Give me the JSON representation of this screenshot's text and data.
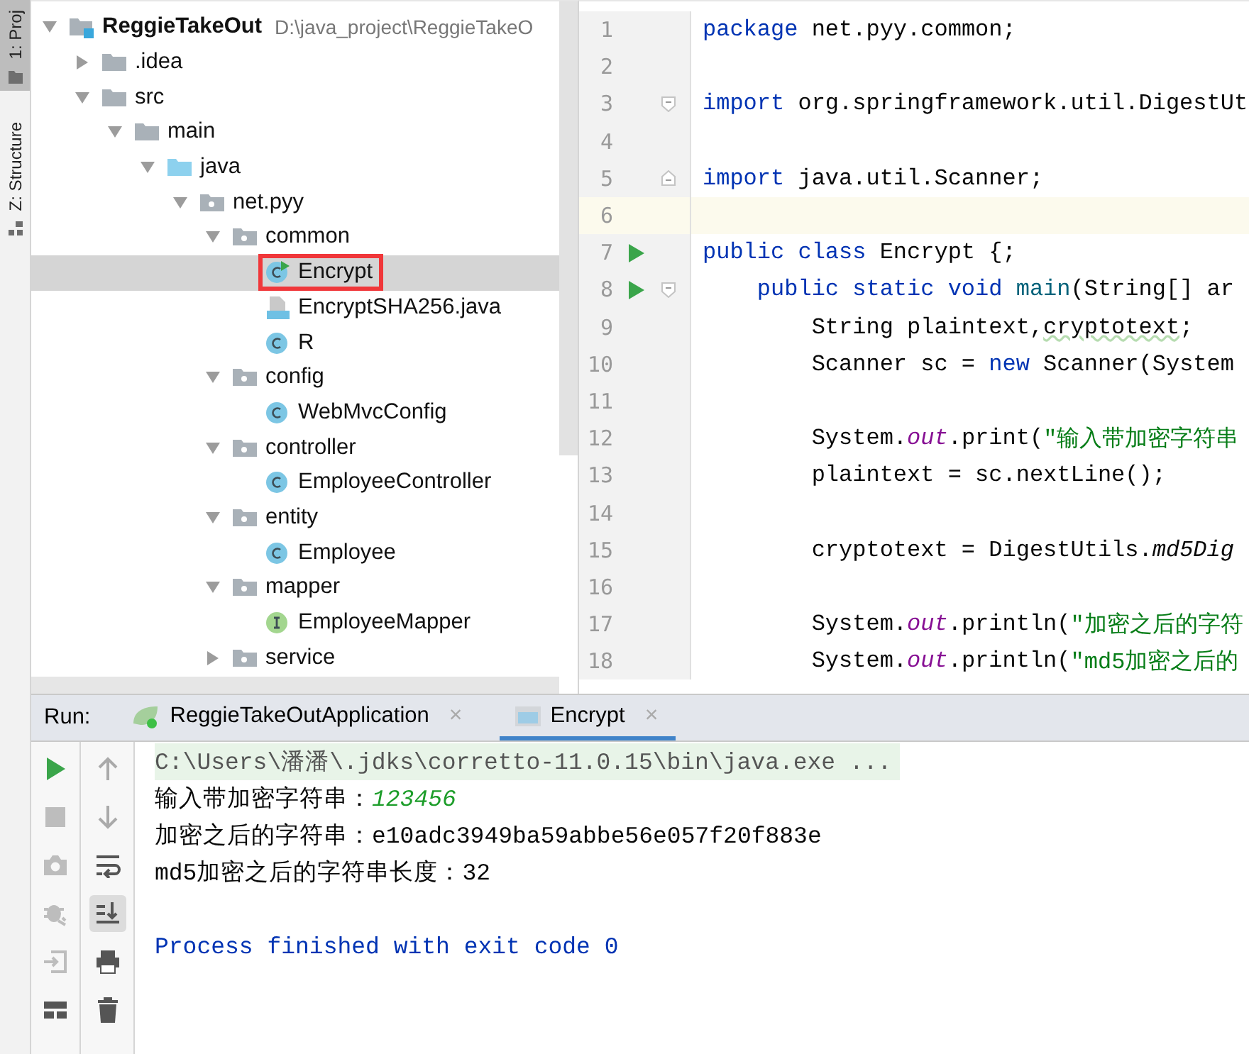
{
  "side_strip": [
    {
      "label": "1: Proj",
      "selected": true,
      "kind": "folder"
    },
    {
      "label": "Z: Structure",
      "selected": false,
      "kind": "structure"
    }
  ],
  "project_tree": [
    {
      "name": "ReggieTakeOut",
      "path": "D:\\java_project\\ReggieTakeO",
      "kind": "module",
      "expanded": true,
      "selected": false,
      "boxed": false,
      "children": [
        {
          "name": ".idea",
          "kind": "folder",
          "expanded": false,
          "selected": false,
          "boxed": false
        },
        {
          "name": "src",
          "kind": "folder",
          "expanded": true,
          "selected": false,
          "boxed": false,
          "children": [
            {
              "name": "main",
              "kind": "folder",
              "expanded": true,
              "selected": false,
              "boxed": false,
              "children": [
                {
                  "name": "java",
                  "kind": "source",
                  "expanded": true,
                  "selected": false,
                  "boxed": false,
                  "children": [
                    {
                      "name": "net.pyy",
                      "kind": "package",
                      "expanded": true,
                      "selected": false,
                      "boxed": false,
                      "children": [
                        {
                          "name": "common",
                          "kind": "package",
                          "expanded": true,
                          "selected": false,
                          "boxed": false,
                          "children": [
                            {
                              "name": "Encrypt",
                              "kind": "runnable",
                              "selected": true,
                              "boxed": true
                            },
                            {
                              "name": "EncryptSHA256.java",
                              "kind": "file",
                              "selected": false,
                              "boxed": false
                            },
                            {
                              "name": "R",
                              "kind": "class",
                              "selected": false,
                              "boxed": false
                            }
                          ]
                        },
                        {
                          "name": "config",
                          "kind": "package",
                          "expanded": true,
                          "selected": false,
                          "boxed": false,
                          "children": [
                            {
                              "name": "WebMvcConfig",
                              "kind": "class",
                              "selected": false,
                              "boxed": false
                            }
                          ]
                        },
                        {
                          "name": "controller",
                          "kind": "package",
                          "expanded": true,
                          "selected": false,
                          "boxed": false,
                          "children": [
                            {
                              "name": "EmployeeController",
                              "kind": "class",
                              "selected": false,
                              "boxed": false
                            }
                          ]
                        },
                        {
                          "name": "entity",
                          "kind": "package",
                          "expanded": true,
                          "selected": false,
                          "boxed": false,
                          "children": [
                            {
                              "name": "Employee",
                              "kind": "class",
                              "selected": false,
                              "boxed": false
                            }
                          ]
                        },
                        {
                          "name": "mapper",
                          "kind": "package",
                          "expanded": true,
                          "selected": false,
                          "boxed": false,
                          "children": [
                            {
                              "name": "EmployeeMapper",
                              "kind": "interface",
                              "selected": false,
                              "boxed": false
                            }
                          ]
                        },
                        {
                          "name": "service",
                          "kind": "package",
                          "expanded": false,
                          "selected": false,
                          "boxed": false
                        }
                      ]
                    }
                  ]
                }
              ]
            }
          ]
        }
      ]
    }
  ],
  "editor": {
    "lines": [
      {
        "number": "1",
        "run": false,
        "fold_open": false,
        "fold_close": false,
        "current": false,
        "tokens": [
          {
            "kind": "keyword",
            "t": "package"
          },
          {
            "kind": "plain",
            "t": " net.pyy.common;"
          }
        ]
      },
      {
        "number": "2",
        "run": false,
        "fold_open": false,
        "fold_close": false,
        "current": false
      },
      {
        "number": "3",
        "run": false,
        "fold_open": true,
        "fold_close": false,
        "current": false,
        "tokens": [
          {
            "kind": "keyword",
            "t": "import"
          },
          {
            "kind": "plain",
            "t": " org.springframework.util.DigestUt"
          }
        ]
      },
      {
        "number": "4",
        "run": false,
        "fold_open": false,
        "fold_close": false,
        "current": false
      },
      {
        "number": "5",
        "run": false,
        "fold_open": false,
        "fold_close": true,
        "current": false,
        "tokens": [
          {
            "kind": "keyword",
            "t": "import"
          },
          {
            "kind": "plain",
            "t": " java.util.Scanner;"
          }
        ]
      },
      {
        "number": "6",
        "run": false,
        "fold_open": false,
        "fold_close": false,
        "current": true
      },
      {
        "number": "7",
        "run": true,
        "fold_open": false,
        "fold_close": false,
        "current": false,
        "tokens": [
          {
            "kind": "keyword",
            "t": "public class"
          },
          {
            "kind": "plain",
            "t": " Encrypt {;"
          }
        ]
      },
      {
        "number": "8",
        "run": true,
        "fold_open": true,
        "fold_close": false,
        "current": false,
        "tokens": [
          {
            "kind": "keyword",
            "t": "    public static void"
          },
          {
            "kind": "method",
            "t": " main"
          },
          {
            "kind": "plain",
            "t": "(String[] ar"
          }
        ]
      },
      {
        "number": "9",
        "run": false,
        "fold_open": false,
        "fold_close": false,
        "current": false,
        "tokens": [
          {
            "kind": "plain",
            "t": "        String plaintext,"
          },
          {
            "kind": "warning",
            "t": "cryptotext"
          },
          {
            "kind": "plain",
            "t": ";"
          }
        ]
      },
      {
        "number": "10",
        "run": false,
        "fold_open": false,
        "fold_close": false,
        "current": false,
        "tokens": [
          {
            "kind": "plain",
            "t": "        Scanner sc = "
          },
          {
            "kind": "keyword",
            "t": "new"
          },
          {
            "kind": "plain",
            "t": " Scanner(System"
          }
        ]
      },
      {
        "number": "11",
        "run": false,
        "fold_open": false,
        "fold_close": false,
        "current": false
      },
      {
        "number": "12",
        "run": false,
        "fold_open": false,
        "fold_close": false,
        "current": false,
        "tokens": [
          {
            "kind": "plain",
            "t": "        System."
          },
          {
            "kind": "field",
            "t": "out"
          },
          {
            "kind": "plain",
            "t": ".print("
          },
          {
            "kind": "string",
            "t": "\"输入带加密字符串"
          }
        ]
      },
      {
        "number": "13",
        "run": false,
        "fold_open": false,
        "fold_close": false,
        "current": false,
        "tokens": [
          {
            "kind": "plain",
            "t": "        plaintext = sc.nextLine();"
          }
        ]
      },
      {
        "number": "14",
        "run": false,
        "fold_open": false,
        "fold_close": false,
        "current": false
      },
      {
        "number": "15",
        "run": false,
        "fold_open": false,
        "fold_close": false,
        "current": false,
        "tokens": [
          {
            "kind": "plain",
            "t": "        cryptotext = DigestUtils."
          },
          {
            "kind": "call",
            "t": "md5Dig"
          }
        ]
      },
      {
        "number": "16",
        "run": false,
        "fold_open": false,
        "fold_close": false,
        "current": false
      },
      {
        "number": "17",
        "run": false,
        "fold_open": false,
        "fold_close": false,
        "current": false,
        "tokens": [
          {
            "kind": "plain",
            "t": "        System."
          },
          {
            "kind": "field",
            "t": "out"
          },
          {
            "kind": "plain",
            "t": ".println("
          },
          {
            "kind": "string",
            "t": "\"加密之后的字符"
          }
        ]
      },
      {
        "number": "18",
        "run": false,
        "fold_open": false,
        "fold_close": false,
        "current": false,
        "tokens": [
          {
            "kind": "plain",
            "t": "        System."
          },
          {
            "kind": "field",
            "t": "out"
          },
          {
            "kind": "plain",
            "t": ".println("
          },
          {
            "kind": "string",
            "t": "\"md5加密之后的"
          }
        ]
      }
    ]
  },
  "run_panel": {
    "label": "Run:",
    "tabs": [
      {
        "label": "ReggieTakeOutApplication",
        "kind": "spring",
        "selected": false,
        "close": "×"
      },
      {
        "label": "Encrypt",
        "kind": "console",
        "selected": true,
        "close": "×"
      }
    ],
    "left_tools": [
      {
        "kind": "run",
        "disabled": false
      },
      {
        "kind": "stop",
        "disabled": true
      },
      {
        "kind": "camera",
        "disabled": true
      },
      {
        "kind": "bug",
        "disabled": true
      },
      {
        "kind": "exit",
        "disabled": true
      },
      {
        "kind": "layout",
        "disabled": false
      }
    ],
    "right_tools": [
      {
        "kind": "up",
        "on": false
      },
      {
        "kind": "down",
        "on": false
      },
      {
        "kind": "wrap",
        "on": false
      },
      {
        "kind": "scroll",
        "on": true
      },
      {
        "kind": "print",
        "on": false
      },
      {
        "kind": "trash",
        "on": false
      }
    ],
    "console": [
      {
        "kind": "command",
        "text": "C:\\Users\\潘潘\\.jdks\\corretto-11.0.15\\bin\\java.exe ..."
      },
      {
        "kind": "input",
        "text": "输入带加密字符串：",
        "input": "123456"
      },
      {
        "kind": "output",
        "text": "加密之后的字符串：e10adc3949ba59abbe56e057f20f883e"
      },
      {
        "kind": "output",
        "text": "md5加密之后的字符串长度：32"
      },
      {
        "kind": "blank"
      },
      {
        "kind": "exit",
        "text": "Process finished with exit code 0"
      }
    ]
  }
}
